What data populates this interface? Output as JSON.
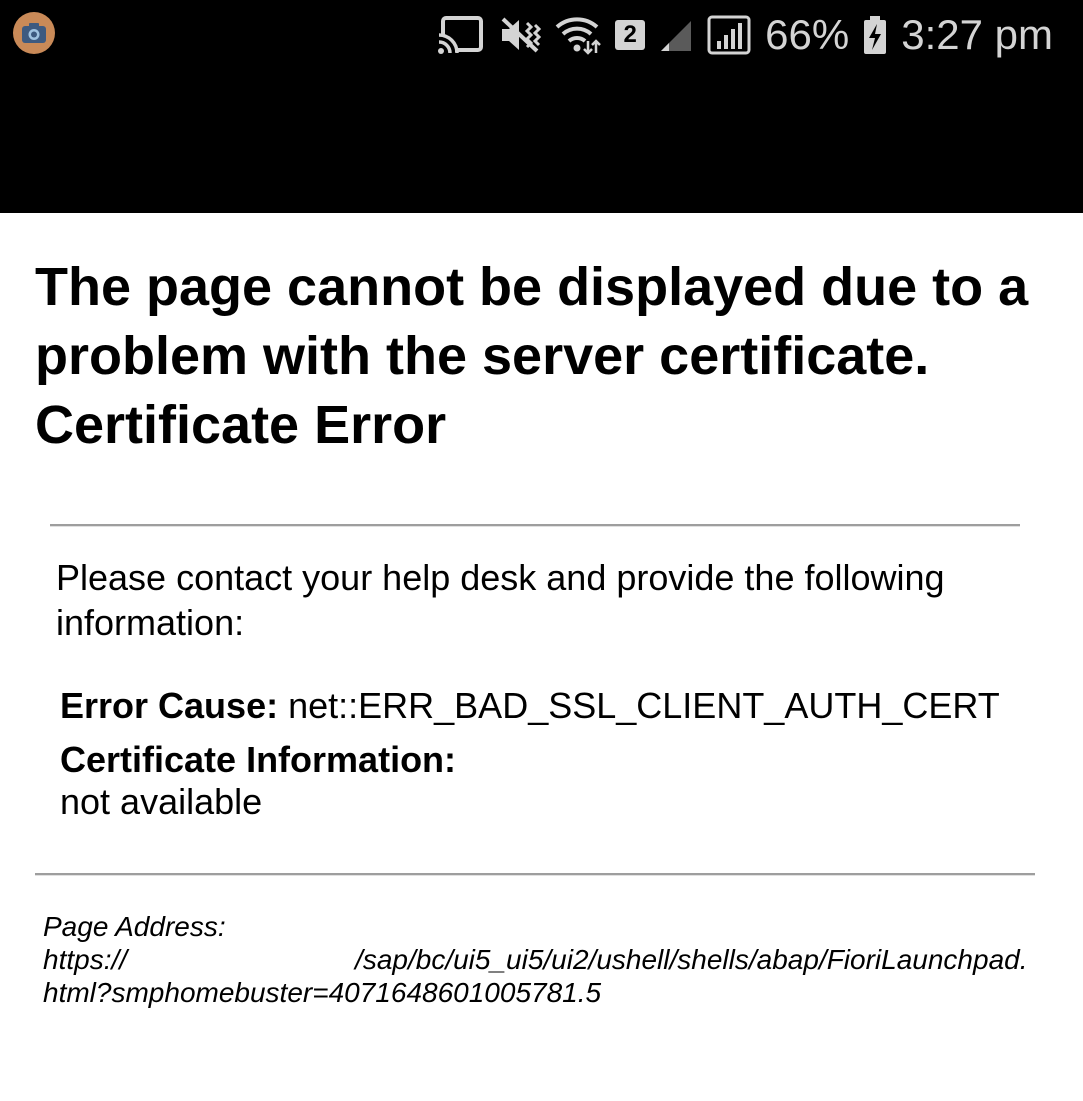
{
  "status_bar": {
    "battery_percent": "66%",
    "time": "3:27 pm",
    "sim_slot": "2",
    "icons": [
      "camera-icon",
      "cast-icon",
      "vibrate-mute-icon",
      "wifi-icon",
      "sim-badge",
      "signal-weak-icon",
      "signal-icon",
      "battery-charging-icon"
    ]
  },
  "page": {
    "heading_line1": "The page cannot be displayed due to a problem with the server certificate.",
    "heading_line2": "Certificate Error",
    "intro": "Please contact your help desk and provide the following information:",
    "error_cause_label": "Error Cause:",
    "error_cause_value": "net::ERR_BAD_SSL_CLIENT_AUTH_CERT",
    "cert_info_label": "Certificate Information:",
    "cert_info_value": "not available",
    "address_label": "Page Address:",
    "address_prefix": "https://",
    "address_path": "/sap/bc/ui5_ui5/ui2/ushell/shells/abap/FioriLaunchpad.html?smphomebuster=4071648601005781.5"
  },
  "colors": {
    "status_bar_bg": "#000000",
    "status_icon": "#d4d4d4",
    "camera_badge": "#c98a58",
    "rule": "#9e9e9e"
  }
}
